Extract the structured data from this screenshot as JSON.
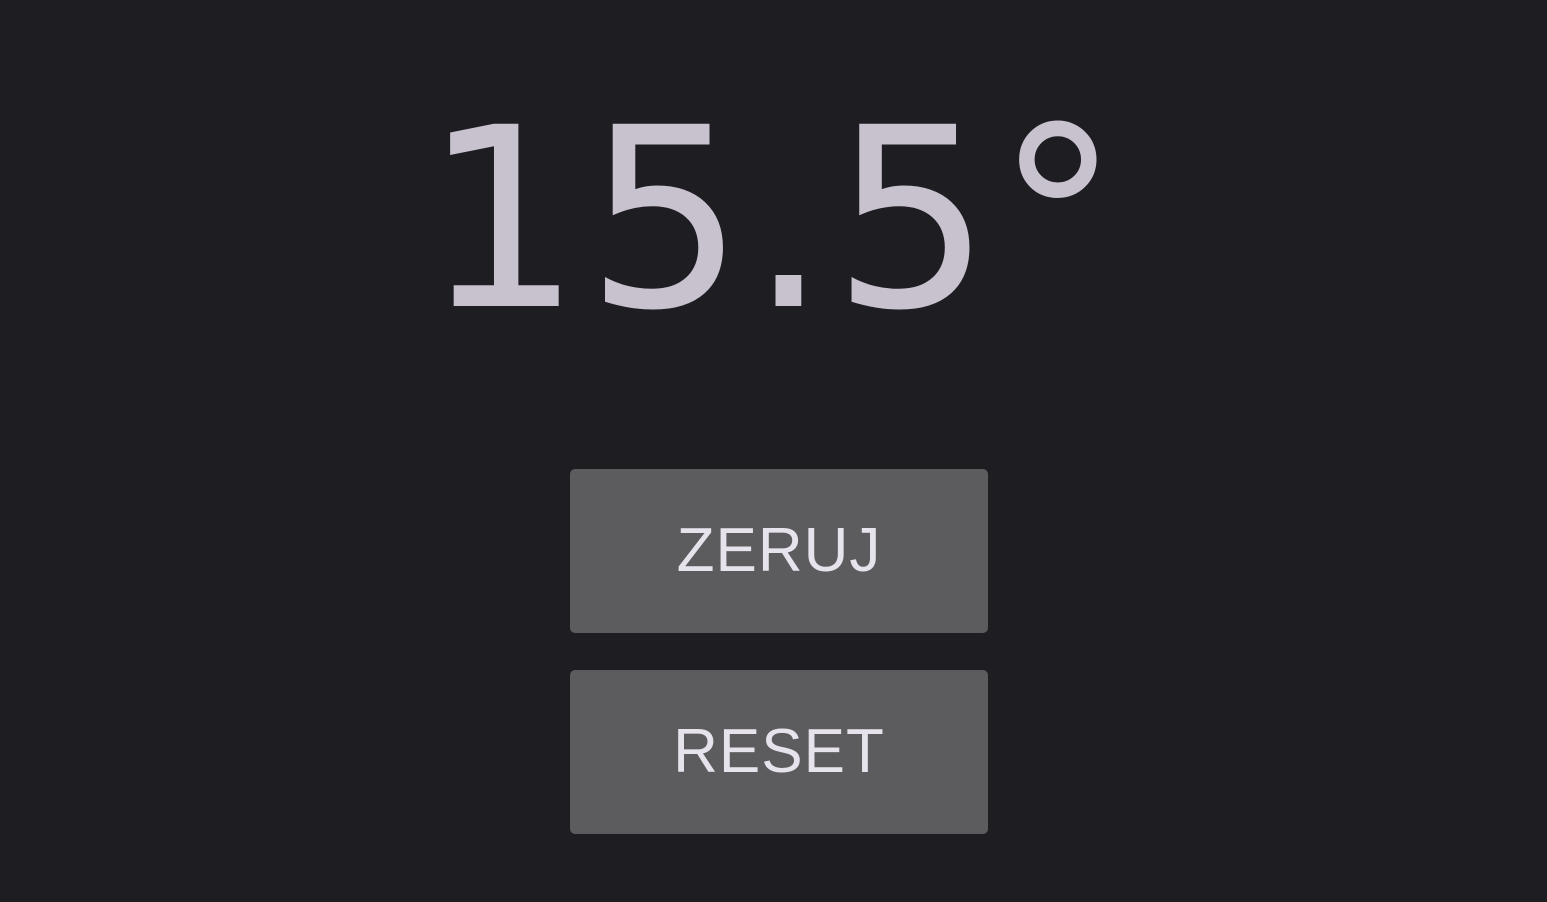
{
  "readout": {
    "value": "15.5°"
  },
  "buttons": {
    "zero_label": "ZERUJ",
    "reset_label": "RESET"
  },
  "colors": {
    "background": "#1e1d22",
    "readout_text": "#c8c2cf",
    "button_bg": "#5c5c5e",
    "button_text": "#e7e3ec"
  }
}
